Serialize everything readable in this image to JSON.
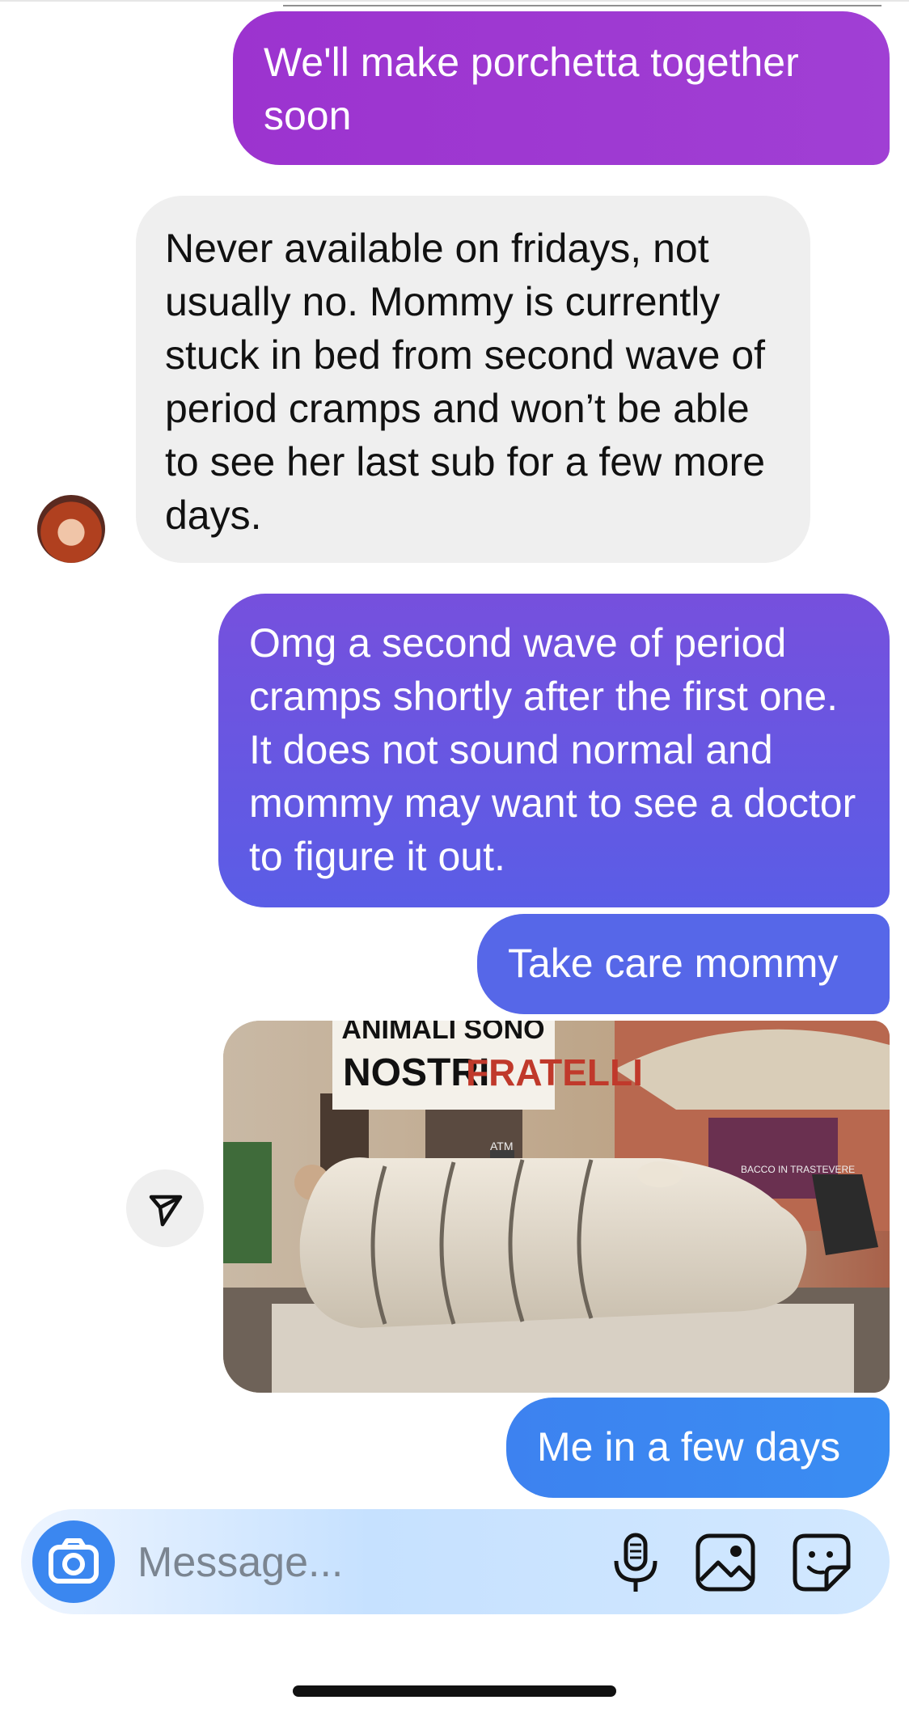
{
  "messages": [
    {
      "id": "m1",
      "direction": "outgoing",
      "text": "We'll make porchetta together soon"
    },
    {
      "id": "m2",
      "direction": "incoming",
      "text": "Never available on fridays, not usually no. Mommy is currently stuck in bed from second wave of period cramps and won’t be able to see her last sub for a few more days."
    },
    {
      "id": "m3",
      "direction": "outgoing",
      "text": "Omg a second wave of period cramps shortly after the first one. It does not sound normal and mommy may want to see a doctor to figure it out."
    },
    {
      "id": "m4",
      "direction": "outgoing",
      "text": "Take care mommy"
    },
    {
      "id": "m6",
      "direction": "outgoing",
      "text": "Me in a few days"
    }
  ],
  "photo": {
    "banner_line1": "ANIMALI SONO",
    "banner_line2a": "NOSTRI",
    "banner_line2b": "FRATELLI",
    "shop_sign": "BACCO IN TRASTEVERE",
    "atm_sign": "ATM"
  },
  "composer": {
    "placeholder": "Message..."
  },
  "icons": {
    "camera": "camera-icon",
    "mic": "microphone-icon",
    "gallery": "gallery-icon",
    "sticker": "sticker-icon",
    "share": "send-paper-plane-icon"
  },
  "colors": {
    "outgoing_purple": "#9c33cf",
    "outgoing_violet": "#6a56e2",
    "outgoing_blue": "#3d82f0",
    "incoming_gray": "#efefef"
  }
}
